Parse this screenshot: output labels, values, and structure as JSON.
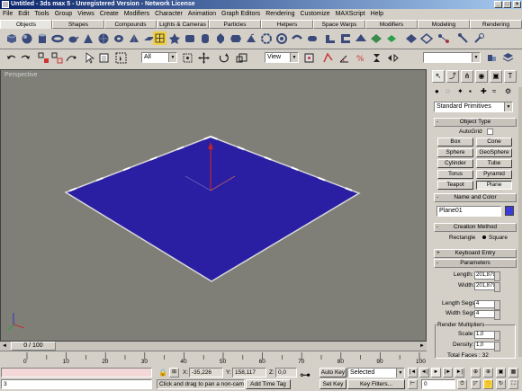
{
  "window": {
    "title": "Untitled - 3ds max 5 - Unregistered Version - Network License"
  },
  "menu": [
    "File",
    "Edit",
    "Tools",
    "Group",
    "Views",
    "Create",
    "Modifiers",
    "Character",
    "Animation",
    "Graph Editors",
    "Rendering",
    "Customize",
    "MAXScript",
    "Help"
  ],
  "tabs": [
    "Objects",
    "Shapes",
    "Compounds",
    "Lights & Cameras",
    "Particles",
    "Helpers",
    "Space Warps",
    "Modifiers",
    "Modeling",
    "Rendering"
  ],
  "toolbar": {
    "selection_filter": "All",
    "ref_coord": "View"
  },
  "viewport": {
    "label": "Perspective",
    "plane_color": "#2a1fa3"
  },
  "command_panel": {
    "category": "Standard Primitives",
    "object_type_title": "Object Type",
    "autogrid_label": "AutoGrid",
    "buttons": [
      "Box",
      "Cone",
      "Sphere",
      "GeoSphere",
      "Cylinder",
      "Tube",
      "Torus",
      "Pyramid",
      "Teapot",
      "Plane"
    ],
    "name_color_title": "Name and Color",
    "object_name": "Plane01",
    "object_color": "#3a3ad8",
    "creation_method_title": "Creation Method",
    "creation_rect": "Rectangle",
    "creation_square": "Square",
    "keyboard_entry_title": "Keyboard Entry",
    "parameters_title": "Parameters",
    "length_label": "Length:",
    "length_value": "201,879",
    "width_label": "Width:",
    "width_value": "201,879",
    "length_segs_label": "Length Segs:",
    "length_segs_value": "4",
    "width_segs_label": "Width Segs:",
    "width_segs_value": "4",
    "render_multipliers_title": "Render Multipliers",
    "scale_label": "Scale:",
    "scale_value": "1,0",
    "density_label": "Density:",
    "density_value": "1,0",
    "total_faces": "Total Faces : 32"
  },
  "timeline": {
    "frame_counter": "0 / 100",
    "ticks": [
      "0",
      "10",
      "20",
      "30",
      "40",
      "50",
      "60",
      "70",
      "80",
      "90",
      "100"
    ]
  },
  "status": {
    "maxscript_value": "3",
    "x_label": "X:",
    "x_value": "-35,226",
    "y_label": "Y:",
    "y_value": "158,117",
    "z_label": "Z:",
    "z_value": "0,0",
    "prompt": "Click and drag to pan a non-camer..",
    "add_time_tag": "Add Time Tag",
    "auto_key": "Auto Key",
    "set_key": "Set Key",
    "key_mode": "Selected",
    "key_filters": "Key Filters...",
    "current_frame": "0"
  }
}
